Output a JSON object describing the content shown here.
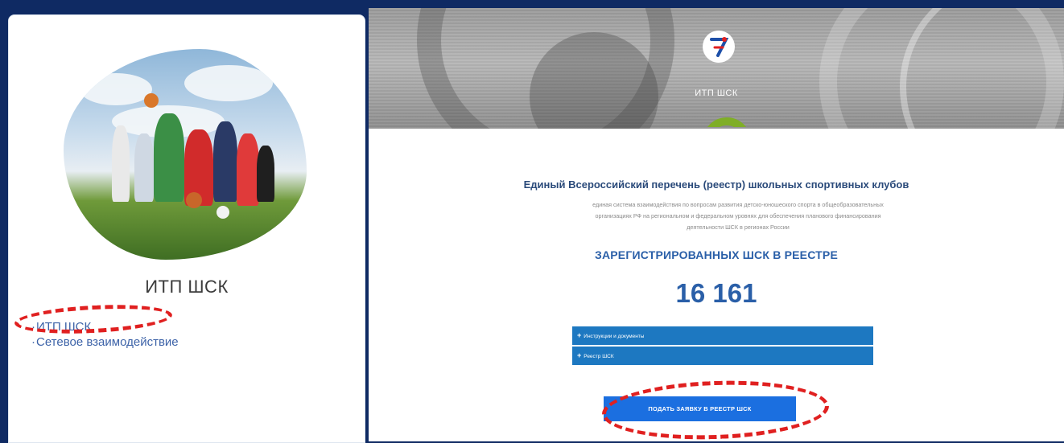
{
  "left_card": {
    "title": "ИТП ШСК",
    "links": [
      {
        "bullet": "·",
        "label": "ИТП ШСК"
      },
      {
        "bullet": "·",
        "label": "Сетевое взаимодействие"
      }
    ]
  },
  "right_panel": {
    "banner_title": "ИТП ШСК",
    "heading": "Единый Всероссийский перечень (реестр) школьных спортивных клубов",
    "description": "единая система взаимодействия по вопросам развития детско-юношеского спорта в общеобразовательных организациях РФ на региональном и федеральном уровнях для обеспечения планового финансирования деятельности ШСК в регионах России",
    "registered_heading": "ЗАРЕГИСТРИРОВАННЫХ ШСК В РЕЕСТРЕ",
    "registered_count": "16 161",
    "accordion": [
      {
        "label": "Инструкции и документы"
      },
      {
        "label": "Реестр ШСК"
      }
    ],
    "apply_button": "ПОДАТЬ ЗАЯВКУ В РЕЕСТР ШСК"
  },
  "colors": {
    "background": "#0f2a63",
    "accent_blue": "#1d78c1",
    "button_blue": "#1b6fe0",
    "annotation_red": "#e02020"
  }
}
